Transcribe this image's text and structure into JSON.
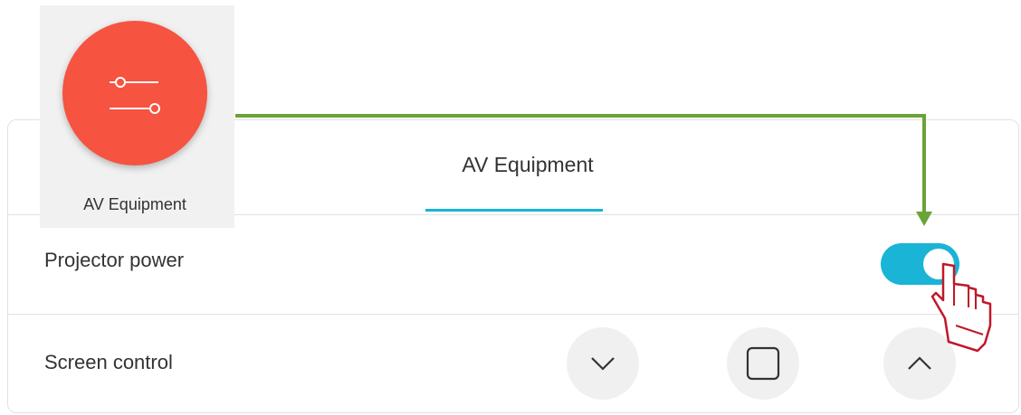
{
  "panel": {
    "tab_label": "AV Equipment",
    "rows": [
      {
        "label": "Projector power",
        "toggle_state": "on"
      },
      {
        "label": "Screen control"
      }
    ]
  },
  "screen_controls": {
    "down_icon": "chevron-down-icon",
    "stop_icon": "square-stop-icon",
    "up_icon": "chevron-up-icon"
  },
  "tile": {
    "label": "AV Equipment",
    "icon": "sliders-icon"
  },
  "colors": {
    "accent": "#19b4d6",
    "tile_circle": "#f65341",
    "annotation_arrow": "#6aa336",
    "cursor_outline": "#c0182a"
  }
}
